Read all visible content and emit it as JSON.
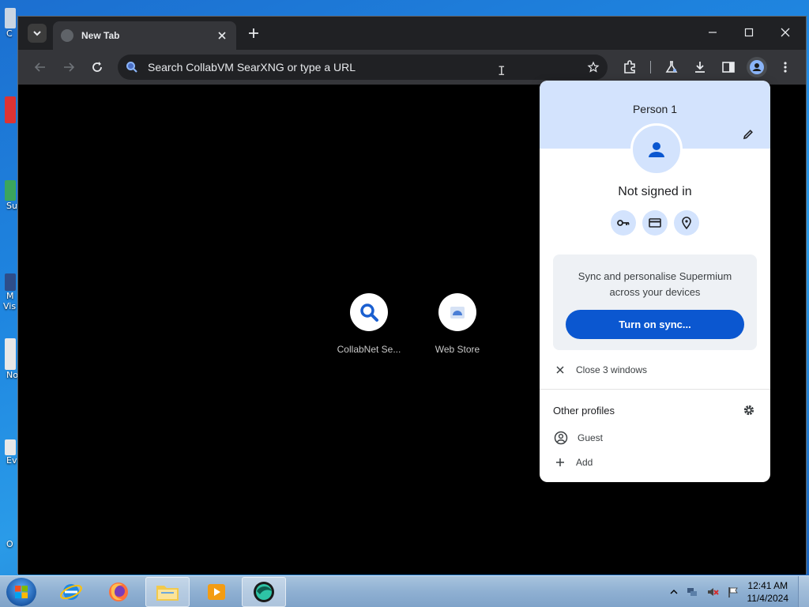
{
  "desktop": {
    "slivers": [
      {
        "label": "C",
        "color": "#c9d5e3"
      },
      {
        "label": "",
        "color": "#d33"
      },
      {
        "label": "Su",
        "color": "#3ba55c"
      },
      {
        "label": "M",
        "color": "#2d4d8a"
      },
      {
        "label": "Vis",
        "color": ""
      },
      {
        "label": "No",
        "color": "#e8e8e8"
      },
      {
        "label": "Ev",
        "color": "#e8e8e8"
      },
      {
        "label": "O",
        "color": ""
      }
    ]
  },
  "browser": {
    "tab": {
      "title": "New Tab",
      "favicon": "globe-icon"
    },
    "omnibox": {
      "placeholder": "Search CollabVM SearXNG or type a URL"
    },
    "shortcuts": [
      {
        "label": "CollabNet Se...",
        "icon": "search-icon",
        "color": "#1a5fd0"
      },
      {
        "label": "Web Store",
        "icon": "web-store-icon",
        "color": "#4a7ed6"
      }
    ]
  },
  "profile_menu": {
    "name": "Person 1",
    "status": "Not signed in",
    "quick_icons": [
      "key-icon",
      "credit-card-icon",
      "location-pin-icon"
    ],
    "sync_text": "Sync and personalise Supermium across your devices",
    "sync_button": "Turn on sync...",
    "close_windows": "Close 3 windows",
    "other_profiles_title": "Other profiles",
    "guest_label": "Guest",
    "add_label": "Add",
    "accent": "#0b57d0",
    "header_color": "#d3e3fd"
  },
  "taskbar": {
    "apps": [
      "internet-explorer-icon",
      "firefox-icon",
      "file-explorer-icon",
      "media-player-icon",
      "supermium-icon"
    ],
    "clock_time": "12:41 AM",
    "clock_date": "11/4/2024"
  }
}
